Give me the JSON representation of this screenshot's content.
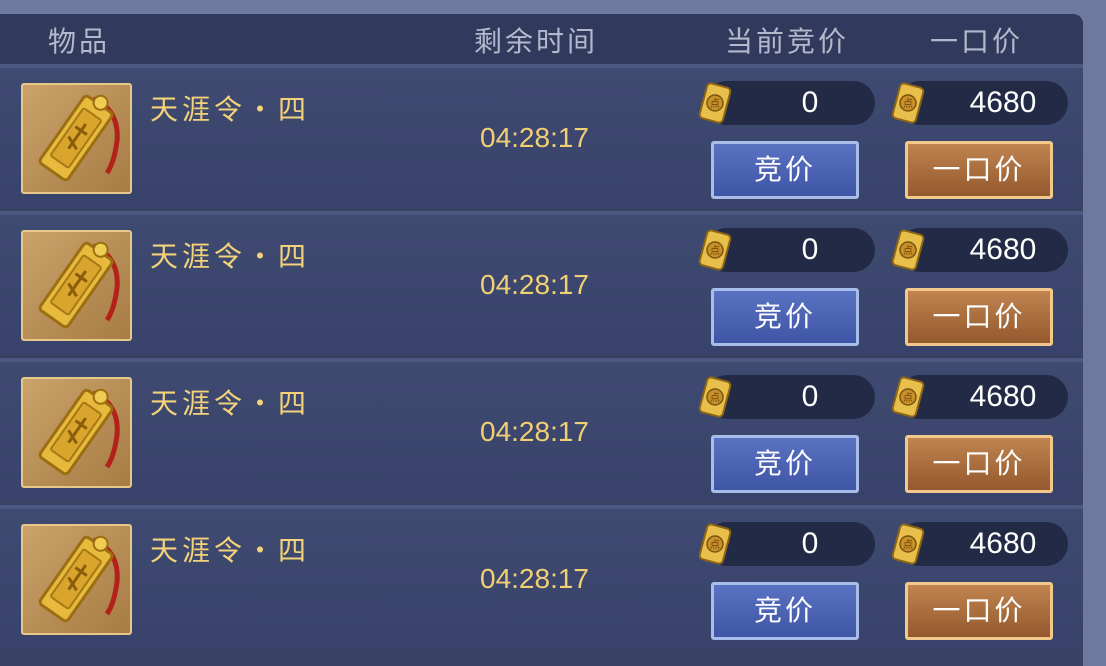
{
  "header": {
    "col_item": "物品",
    "col_time": "剩余时间",
    "col_bid": "当前竞价",
    "col_buyout": "一口价"
  },
  "rows": [
    {
      "name": "天涯令・四",
      "time": "04:28:17",
      "current_bid": "0",
      "buyout": "4680",
      "bid_label": "竞价",
      "buy_label": "一口价",
      "icon": "tianya-token-icon"
    },
    {
      "name": "天涯令・四",
      "time": "04:28:17",
      "current_bid": "0",
      "buyout": "4680",
      "bid_label": "竞价",
      "buy_label": "一口价",
      "icon": "tianya-token-icon"
    },
    {
      "name": "天涯令・四",
      "time": "04:28:17",
      "current_bid": "0",
      "buyout": "4680",
      "bid_label": "竞价",
      "buy_label": "一口价",
      "icon": "tianya-token-icon"
    },
    {
      "name": "天涯令・四",
      "time": "04:28:17",
      "current_bid": "0",
      "buyout": "4680",
      "bid_label": "竞价",
      "buy_label": "一口价",
      "icon": "tianya-token-icon"
    }
  ],
  "currency_icon": "scroll-coin-icon",
  "colors": {
    "name": "#f3d27a",
    "time": "#f1cf73",
    "bid_button": "#4a62b3",
    "buy_button": "#a86a3a"
  }
}
